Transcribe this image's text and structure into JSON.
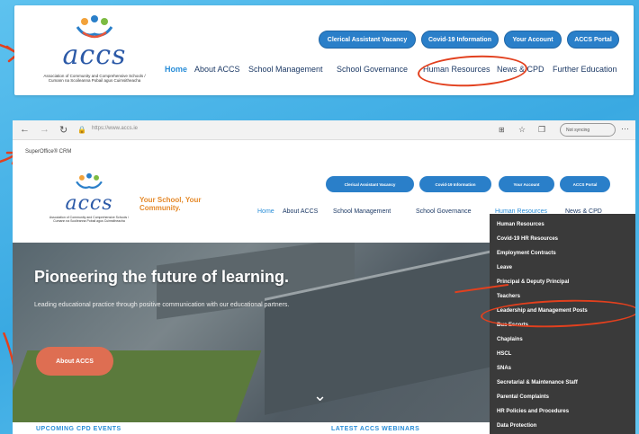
{
  "top": {
    "logo_word": "accs",
    "logo_subtitle": "Association of Community and Comprehensive Schools / Cumann na Scoileanna Pobail agus Cuimsitheacha",
    "buttons": [
      "Clerical Assistant Vacancy",
      "Covid-19 Information",
      "Your Account",
      "ACCS Portal"
    ],
    "nav": [
      "Home",
      "About ACCS",
      "School Management",
      "School Governance",
      "Human Resources",
      "News & CPD",
      "Further Education"
    ]
  },
  "browser": {
    "url": "https://www.accs.ie",
    "sync_label": "Not syncing",
    "bookmark": "SuperOffice® CRM"
  },
  "site": {
    "logo_word": "accs",
    "logo_subtitle": "Association of Community and Comprehensive Schools / Cumann na Scoileanna Pobail agus Cuimsitheacha",
    "tagline_line1": "Your School, Your",
    "tagline_line2": "Community.",
    "buttons": [
      "Clerical Assistant Vacancy",
      "Covid-19 Information",
      "Your Account",
      "ACCS Portal"
    ],
    "nav": [
      "Home",
      "About ACCS",
      "School Management",
      "School Governance",
      "Human Resources",
      "News & CPD"
    ]
  },
  "hero": {
    "title": "Pioneering the future of learning.",
    "text": "Leading educational practice through positive communication with our educational partners.",
    "button": "About ACCS"
  },
  "dropdown": {
    "items": [
      "Human Resources",
      "Covid-19 HR Resources",
      "Employment Contracts",
      "Leave",
      "Principal & Deputy Principal",
      "Teachers",
      "Leadership and Management Posts",
      "Bus Escorts",
      "Chaplains",
      "HSCL",
      "SNAs",
      "Secretarial & Maintenance Staff",
      "Parental Complaints",
      "HR Policies and Procedures",
      "Data Protection"
    ]
  },
  "bottom": {
    "left": "UPCOMING CPD EVENTS",
    "right": "LATEST ACCS WEBINARS"
  },
  "colors": {
    "accent_blue": "#2a7fc9",
    "annotation_red": "#e2401e",
    "tagline_orange": "#e58a2b",
    "hero_button": "#de6e52"
  }
}
